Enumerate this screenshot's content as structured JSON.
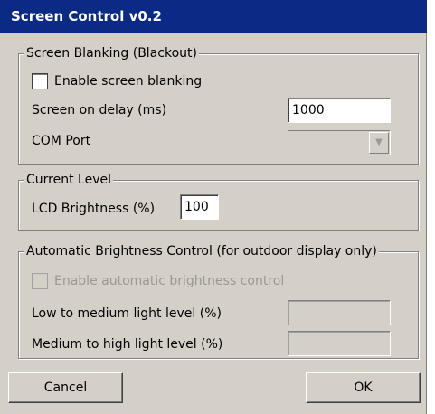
{
  "window": {
    "title": "Screen Control v0.2"
  },
  "blanking": {
    "legend": "Screen Blanking (Blackout)",
    "enable_label": "Enable screen blanking",
    "enable_checked": false,
    "delay_label": "Screen on delay (ms)",
    "delay_value": "1000",
    "com_label": "COM Port",
    "com_value": ""
  },
  "current": {
    "legend": "Current Level",
    "brightness_label": "LCD Brightness (%)",
    "brightness_value": "100"
  },
  "auto": {
    "legend": "Automatic Brightness Control (for outdoor display only)",
    "enable_label": "Enable automatic brightness control",
    "enable_checked": false,
    "low_label": "Low to medium light level (%)",
    "low_value": "",
    "high_label": "Medium to high light level (%)",
    "high_value": ""
  },
  "buttons": {
    "cancel": "Cancel",
    "ok": "OK"
  }
}
